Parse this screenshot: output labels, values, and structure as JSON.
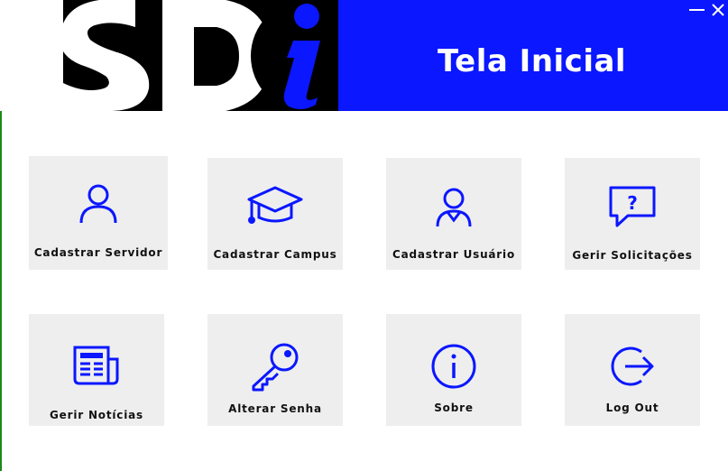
{
  "header": {
    "logo_text": "SDi",
    "title": "Tela Inicial",
    "minimize_label": "—",
    "close_label": "✕"
  },
  "tiles": [
    {
      "label": "Cadastrar Servidor",
      "icon": "user-icon"
    },
    {
      "label": "Cadastrar Campus",
      "icon": "graduation-cap-icon"
    },
    {
      "label": "Cadastrar Usuário",
      "icon": "user-badge-icon"
    },
    {
      "label": "Gerir Solicitações",
      "icon": "question-bubble-icon"
    },
    {
      "label": "Gerir Notícias",
      "icon": "newspaper-icon"
    },
    {
      "label": "Alterar Senha",
      "icon": "key-icon"
    },
    {
      "label": "Sobre",
      "icon": "info-icon"
    },
    {
      "label": "Log Out",
      "icon": "logout-icon"
    }
  ],
  "colors": {
    "accent": "#0a17ff",
    "tile_bg": "#eeeeee",
    "logo_bg": "#000000"
  }
}
